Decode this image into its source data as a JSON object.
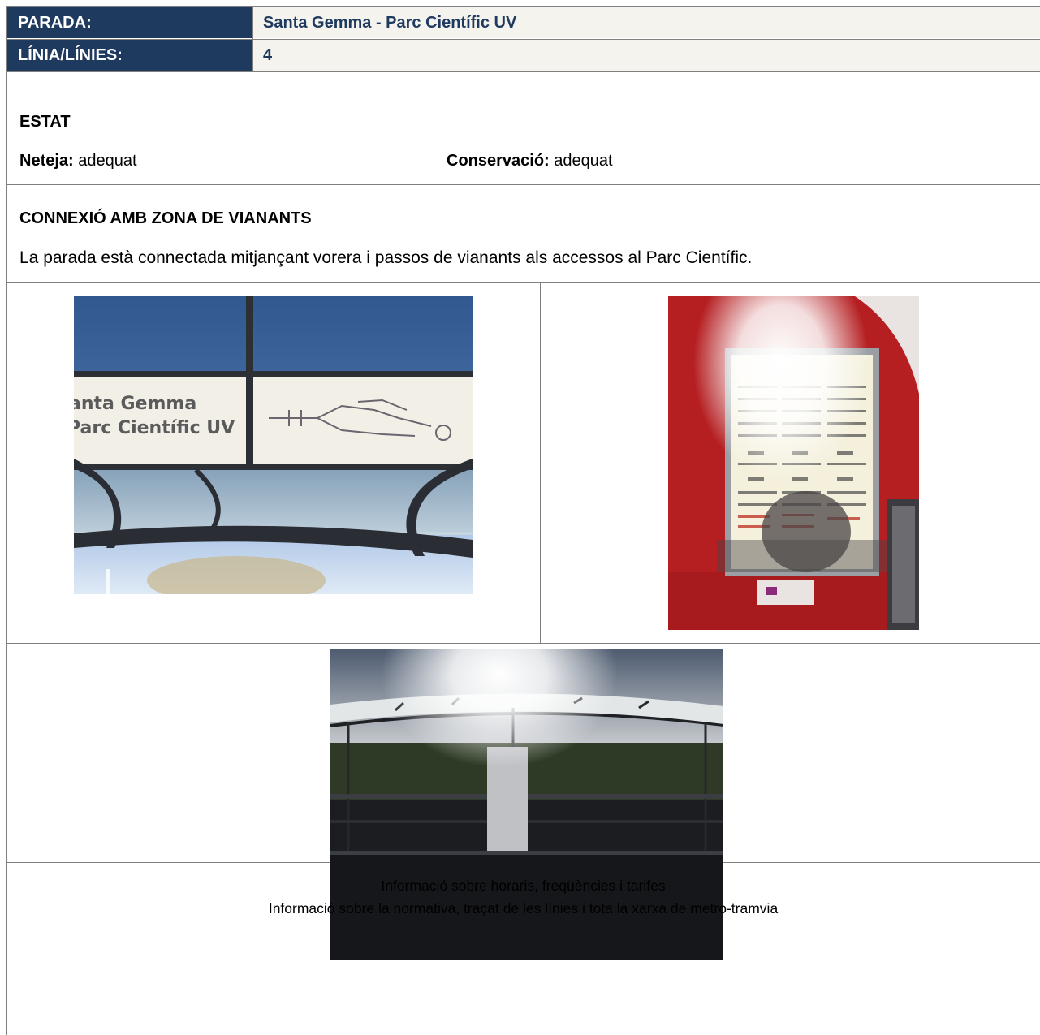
{
  "header": {
    "parada_label": "PARADA:",
    "parada_value": "Santa Gemma - Parc Científic UV",
    "linies_label": "LÍNIA/LÍNIES:",
    "linies_value": "4"
  },
  "estat": {
    "title": "ESTAT",
    "neteja_label": "Neteja:",
    "neteja_value": "adequat",
    "conservacio_label": "Conservació:",
    "conservacio_value": "adequat"
  },
  "connexio": {
    "title": "CONNEXIÓ AMB ZONA DE VIANANTS",
    "text": "La parada està connectada mitjançant vorera i passos de vianants als accessos al Parc Científic."
  },
  "photos": {
    "sign_line1": "anta Gemma",
    "sign_line2": "Parc Científic UV"
  },
  "captions": {
    "line1": "Informació sobre horaris, freqüències i tarifes",
    "line2": "Informació sobre la normativa, traçat de les línies i tota la xarxa de metro-tramvia"
  },
  "colors": {
    "header_bg": "#1f3a5f",
    "header_value_bg": "#f5f3ee",
    "border": "#7f7f7f"
  }
}
